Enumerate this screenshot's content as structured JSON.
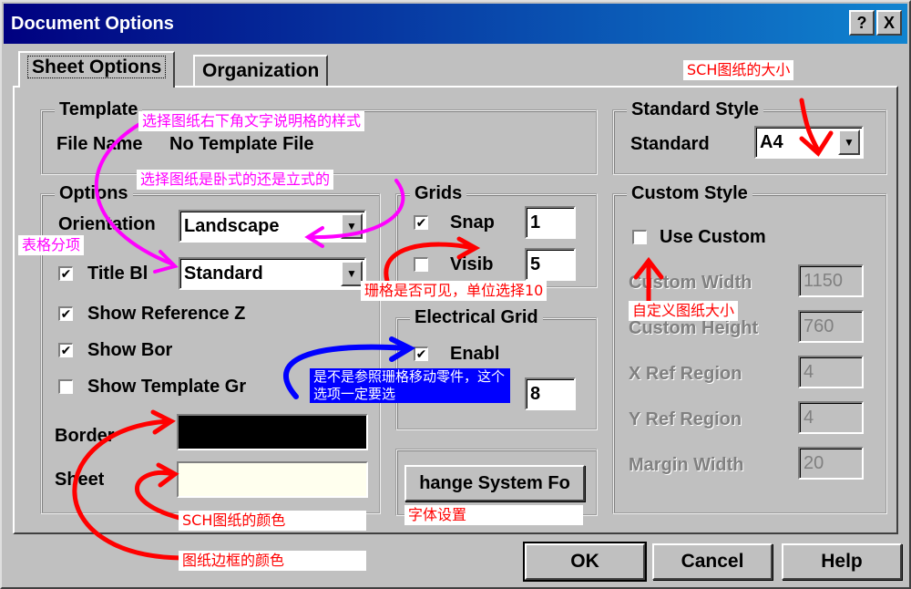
{
  "window": {
    "title": "Document Options",
    "help_button": "?",
    "close_button": "X"
  },
  "tabs": [
    {
      "label": "Sheet Options"
    },
    {
      "label": "Organization"
    }
  ],
  "template": {
    "group_label": "Template",
    "file_name_label": "File Name",
    "file_name_value": "No Template File"
  },
  "options": {
    "group_label": "Options",
    "orientation_label": "Orientation",
    "orientation_value": "Landscape",
    "title_block_label": "Title Bl",
    "title_block_value": "Standard",
    "title_block_checked": "✔",
    "show_reference_label": "Show Reference Z",
    "show_reference_checked": "✔",
    "show_border_label": "Show Bor",
    "show_border_checked": "✔",
    "show_template_label": "Show Template Gr",
    "border_label": "Border",
    "sheet_label": "Sheet",
    "border_color": "#000000",
    "sheet_color": "#ffffee"
  },
  "grids": {
    "group_label": "Grids",
    "snap_label": "Snap",
    "snap_checked": "✔",
    "snap_value": "1",
    "visible_label": "Visib",
    "visible_value": "5"
  },
  "electrical_grid": {
    "group_label": "Electrical Grid",
    "enable_label": "Enabl",
    "enable_checked": "✔",
    "grid_value": "8"
  },
  "change_font_button": "hange System Fo",
  "standard_style": {
    "group_label": "Standard Style",
    "standard_label": "Standard",
    "standard_value": "A4"
  },
  "custom_style": {
    "group_label": "Custom Style",
    "use_custom_label": "Use Custom",
    "custom_width_label": "Custom Width",
    "custom_width_value": "1150",
    "custom_height_label": "Custom Height",
    "custom_height_value": "760",
    "x_ref_label": "X Ref Region",
    "x_ref_value": "4",
    "y_ref_label": "Y Ref Region",
    "y_ref_value": "4",
    "margin_label": "Margin Width",
    "margin_value": "20"
  },
  "buttons": {
    "ok": "OK",
    "cancel": "Cancel",
    "help": "Help"
  },
  "annotations": {
    "template_style": "选择图纸右下角文字说明格的样式",
    "orientation": "选择图纸是卧式的还是立式的",
    "title_block": "表格分项",
    "sch_size": "SCH图纸的大小",
    "grid_visible": "珊格是否可见，单位选择10",
    "custom_size": "自定义图纸大小",
    "electrical": "是不是参照珊格移动零件，这个选项一定要选",
    "sheet_color": "SCH图纸的颜色",
    "border_color": "图纸边框的颜色",
    "font_setting": "字体设置"
  }
}
